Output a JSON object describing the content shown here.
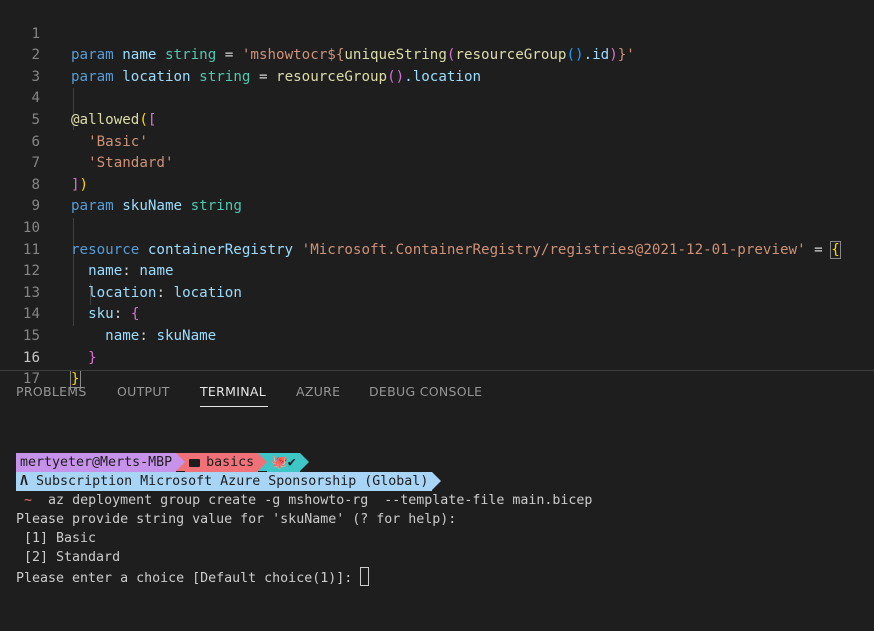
{
  "editor": {
    "active_line": "16",
    "line_numbers": [
      "1",
      "2",
      "3",
      "4",
      "5",
      "6",
      "7",
      "8",
      "9",
      "10",
      "11",
      "12",
      "13",
      "14",
      "15",
      "16",
      "17"
    ],
    "tokens": {
      "l1": [
        "param",
        "name",
        "string",
        "=",
        "'mshowtocr${",
        "uniqueString",
        "(",
        "resourceGroup",
        "()",
        ".id",
        ")",
        "}'"
      ],
      "l2": [
        "param",
        "location",
        "string",
        "=",
        "resourceGroup",
        "()",
        ".location"
      ],
      "l4": [
        "@allowed",
        "(",
        "["
      ],
      "l5": [
        "'Basic'"
      ],
      "l6": [
        "'Standard'"
      ],
      "l7": [
        "]",
        ")"
      ],
      "l8": [
        "param",
        "skuName",
        "string"
      ],
      "l10": [
        "resource",
        "containerRegistry",
        "'Microsoft.ContainerRegistry/registries@2021-12-01-preview'",
        "=",
        "{"
      ],
      "l11": [
        "name",
        ":",
        "name"
      ],
      "l12": [
        "location",
        ":",
        "location"
      ],
      "l13": [
        "sku",
        ":",
        "{"
      ],
      "l14": [
        "name",
        ":",
        "skuName"
      ],
      "l15": [
        "}"
      ],
      "l16": [
        "}"
      ]
    }
  },
  "panel": {
    "tabs": [
      "PROBLEMS",
      "OUTPUT",
      "TERMINAL",
      "AZURE",
      "DEBUG CONSOLE"
    ],
    "active_tab": "TERMINAL"
  },
  "terminal": {
    "prompt_user": "mertyeter@Merts-MBP",
    "prompt_dir_icon": "folder-icon",
    "prompt_dir": "basics",
    "prompt_git_icons": "🐙✔",
    "subscription_label": "Subscription",
    "subscription_value": "Microsoft Azure Sponsorship (Global)",
    "command_prefix": "~",
    "command": "az deployment group create -g mshowto-rg  --template-file main.bicep",
    "output": [
      "Please provide string value for 'skuName' (? for help):",
      " [1] Basic",
      " [2] Standard"
    ],
    "choice_prompt": "Please enter a choice [Default choice(1)]: "
  },
  "colors": {
    "background": "#1e1e1e",
    "keyword": "#569cd6",
    "identifier": "#9cdcfe",
    "type": "#4ec9b0",
    "string": "#ce9178",
    "function": "#dcdcaa",
    "segment_user": "#c792ea",
    "segment_dir": "#f07178",
    "segment_git": "#3ec5c5",
    "segment_subscription": "#a8d4f5"
  }
}
